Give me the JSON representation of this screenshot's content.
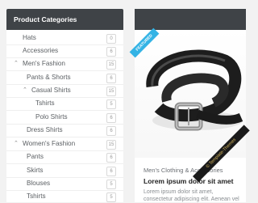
{
  "sidebar": {
    "title": "Product Categories",
    "items": [
      {
        "label": "Hats",
        "count": "0",
        "expanded": false,
        "has_children": false
      },
      {
        "label": "Accessories",
        "count": "6",
        "expanded": false,
        "has_children": false
      },
      {
        "label": "Men's Fashion",
        "count": "15",
        "expanded": true,
        "has_children": true
      },
      {
        "label": "Pants & Shorts",
        "count": "6",
        "expanded": false,
        "has_children": false
      },
      {
        "label": "Casual Shirts",
        "count": "15",
        "expanded": true,
        "has_children": true
      },
      {
        "label": "Tshirts",
        "count": "5",
        "expanded": false,
        "has_children": false
      },
      {
        "label": "Polo Shirts",
        "count": "6",
        "expanded": false,
        "has_children": false
      },
      {
        "label": "Dress Shirts",
        "count": "6",
        "expanded": false,
        "has_children": false
      },
      {
        "label": "Women's Fashion",
        "count": "15",
        "expanded": true,
        "has_children": true
      },
      {
        "label": "Pants",
        "count": "6",
        "expanded": false,
        "has_children": false
      },
      {
        "label": "Skirts",
        "count": "6",
        "expanded": false,
        "has_children": false
      },
      {
        "label": "Blouses",
        "count": "5",
        "expanded": false,
        "has_children": false
      },
      {
        "label": "Tshirts",
        "count": "5",
        "expanded": false,
        "has_children": false
      }
    ]
  },
  "product": {
    "badge": "FEATURED",
    "category": "Men's Clothing & Accessories",
    "title": "Lorem ipsum dolor sit amet",
    "description": "Lorem ipsum dolor sit amet, consectetur adipiscing elit. Aenean vel"
  },
  "watermark": "© Template-Themes",
  "colors": {
    "header_bg": "#3f4347",
    "ribbon": "#33b3e5"
  }
}
